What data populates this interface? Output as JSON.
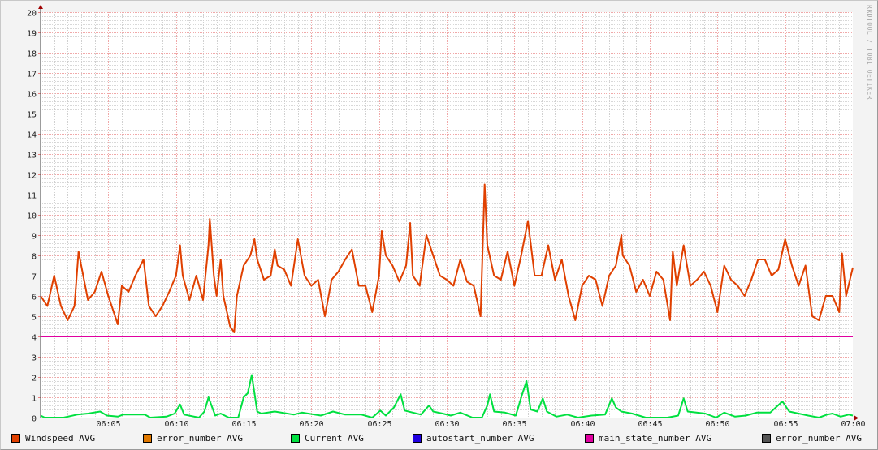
{
  "watermark": "RRDTOOL / TOBI OETIKER",
  "chart_data": {
    "type": "line",
    "title": "",
    "xlabel": "",
    "ylabel": "",
    "x_unit": "minutes after 06:00",
    "xlim": [
      0,
      60
    ],
    "ylim": [
      0,
      20
    ],
    "grid": true,
    "y_ticks": [
      "0",
      "1",
      "2",
      "3",
      "4",
      "5",
      "6",
      "7",
      "8",
      "9",
      "10",
      "11",
      "12",
      "13",
      "14",
      "15",
      "16",
      "17",
      "18",
      "19",
      "20"
    ],
    "x_ticks": [
      {
        "t": 5,
        "label": "06:05"
      },
      {
        "t": 10,
        "label": "06:10"
      },
      {
        "t": 15,
        "label": "06:15"
      },
      {
        "t": 20,
        "label": "06:20"
      },
      {
        "t": 25,
        "label": "06:25"
      },
      {
        "t": 30,
        "label": "06:30"
      },
      {
        "t": 35,
        "label": "06:35"
      },
      {
        "t": 40,
        "label": "06:40"
      },
      {
        "t": 45,
        "label": "06:45"
      },
      {
        "t": 50,
        "label": "06:50"
      },
      {
        "t": 55,
        "label": "06:55"
      },
      {
        "t": 60,
        "label": "07:00"
      }
    ],
    "legend_placement": "bottom",
    "legend": [
      {
        "label": "Windspeed AVG",
        "color": "#e04000"
      },
      {
        "label": "error_number AVG",
        "color": "#e07800"
      },
      {
        "label": "Current AVG",
        "color": "#00e040"
      },
      {
        "label": "autostart_number AVG",
        "color": "#2000e0"
      },
      {
        "label": "main_state_number AVG",
        "color": "#e000a0"
      },
      {
        "label": "error_number AVG",
        "color": "#555555"
      }
    ],
    "series": [
      {
        "name": "Windspeed AVG",
        "color": "#e04000",
        "points": [
          [
            0,
            6.0
          ],
          [
            0.5,
            5.5
          ],
          [
            1,
            7.0
          ],
          [
            1.5,
            5.5
          ],
          [
            2,
            4.8
          ],
          [
            2.5,
            5.5
          ],
          [
            2.8,
            8.2
          ],
          [
            3,
            7.5
          ],
          [
            3.5,
            5.8
          ],
          [
            4,
            6.2
          ],
          [
            4.5,
            7.2
          ],
          [
            5,
            6.0
          ],
          [
            5.5,
            5.0
          ],
          [
            5.7,
            4.6
          ],
          [
            6,
            6.5
          ],
          [
            6.5,
            6.2
          ],
          [
            7,
            7.0
          ],
          [
            7.6,
            7.8
          ],
          [
            8,
            5.5
          ],
          [
            8.5,
            5.0
          ],
          [
            9,
            5.5
          ],
          [
            9.5,
            6.2
          ],
          [
            10,
            7.0
          ],
          [
            10.3,
            8.5
          ],
          [
            10.5,
            7.0
          ],
          [
            11,
            5.8
          ],
          [
            11.5,
            7.0
          ],
          [
            12,
            5.8
          ],
          [
            12.4,
            8.5
          ],
          [
            12.5,
            9.8
          ],
          [
            12.8,
            7.0
          ],
          [
            13,
            6.0
          ],
          [
            13.3,
            7.8
          ],
          [
            13.5,
            6.0
          ],
          [
            14,
            4.5
          ],
          [
            14.3,
            4.2
          ],
          [
            14.5,
            6.0
          ],
          [
            15,
            7.5
          ],
          [
            15.5,
            8.0
          ],
          [
            15.8,
            8.8
          ],
          [
            16,
            7.8
          ],
          [
            16.5,
            6.8
          ],
          [
            17,
            7.0
          ],
          [
            17.3,
            8.3
          ],
          [
            17.5,
            7.5
          ],
          [
            18,
            7.3
          ],
          [
            18.5,
            6.5
          ],
          [
            19,
            8.8
          ],
          [
            19.5,
            7.0
          ],
          [
            20,
            6.5
          ],
          [
            20.5,
            6.8
          ],
          [
            21,
            5.0
          ],
          [
            21.5,
            6.8
          ],
          [
            22,
            7.2
          ],
          [
            22.5,
            7.8
          ],
          [
            23,
            8.3
          ],
          [
            23.5,
            6.5
          ],
          [
            24,
            6.5
          ],
          [
            24.5,
            5.2
          ],
          [
            25,
            7.0
          ],
          [
            25.2,
            9.2
          ],
          [
            25.5,
            8.0
          ],
          [
            26,
            7.5
          ],
          [
            26.5,
            6.7
          ],
          [
            27,
            7.5
          ],
          [
            27.3,
            9.6
          ],
          [
            27.5,
            7.0
          ],
          [
            28,
            6.5
          ],
          [
            28.5,
            9.0
          ],
          [
            29,
            8.0
          ],
          [
            29.5,
            7.0
          ],
          [
            30,
            6.8
          ],
          [
            30.5,
            6.5
          ],
          [
            31,
            7.8
          ],
          [
            31.5,
            6.7
          ],
          [
            32,
            6.5
          ],
          [
            32.5,
            5.0
          ],
          [
            32.8,
            11.5
          ],
          [
            33,
            8.5
          ],
          [
            33.5,
            7.0
          ],
          [
            34,
            6.8
          ],
          [
            34.5,
            8.2
          ],
          [
            35,
            6.5
          ],
          [
            35.5,
            8.0
          ],
          [
            36,
            9.7
          ],
          [
            36.5,
            7.0
          ],
          [
            37,
            7.0
          ],
          [
            37.5,
            8.5
          ],
          [
            38,
            6.8
          ],
          [
            38.5,
            7.8
          ],
          [
            39,
            6.0
          ],
          [
            39.5,
            4.8
          ],
          [
            40,
            6.5
          ],
          [
            40.5,
            7.0
          ],
          [
            41,
            6.8
          ],
          [
            41.5,
            5.5
          ],
          [
            42,
            7.0
          ],
          [
            42.5,
            7.5
          ],
          [
            42.9,
            9.0
          ],
          [
            43,
            8.0
          ],
          [
            43.5,
            7.5
          ],
          [
            44,
            6.2
          ],
          [
            44.5,
            6.8
          ],
          [
            45,
            6.0
          ],
          [
            45.5,
            7.2
          ],
          [
            46,
            6.8
          ],
          [
            46.5,
            4.8
          ],
          [
            46.7,
            8.2
          ],
          [
            47,
            6.5
          ],
          [
            47.5,
            8.5
          ],
          [
            48,
            6.5
          ],
          [
            48.5,
            6.8
          ],
          [
            49,
            7.2
          ],
          [
            49.5,
            6.5
          ],
          [
            50,
            5.2
          ],
          [
            50.5,
            7.5
          ],
          [
            51,
            6.8
          ],
          [
            51.5,
            6.5
          ],
          [
            52,
            6.0
          ],
          [
            52.5,
            6.8
          ],
          [
            53,
            7.8
          ],
          [
            53.5,
            7.8
          ],
          [
            54,
            7.0
          ],
          [
            54.5,
            7.3
          ],
          [
            55,
            8.8
          ],
          [
            55.5,
            7.5
          ],
          [
            56,
            6.5
          ],
          [
            56.5,
            7.5
          ],
          [
            57,
            5.0
          ],
          [
            57.5,
            4.8
          ],
          [
            58,
            6.0
          ],
          [
            58.5,
            6.0
          ],
          [
            59,
            5.2
          ],
          [
            59.2,
            8.1
          ],
          [
            59.5,
            6.0
          ],
          [
            60,
            7.4
          ]
        ]
      },
      {
        "name": "Current AVG",
        "color": "#00e040",
        "points": [
          [
            0,
            0.1
          ],
          [
            0.3,
            0
          ],
          [
            1.7,
            0
          ],
          [
            2.7,
            0.15
          ],
          [
            3.5,
            0.2
          ],
          [
            4.4,
            0.3
          ],
          [
            4.9,
            0.1
          ],
          [
            5.7,
            0.05
          ],
          [
            6.1,
            0.15
          ],
          [
            7.7,
            0.15
          ],
          [
            8.1,
            0
          ],
          [
            9.3,
            0.05
          ],
          [
            9.9,
            0.2
          ],
          [
            10.3,
            0.65
          ],
          [
            10.6,
            0.15
          ],
          [
            11.7,
            0
          ],
          [
            12.1,
            0.3
          ],
          [
            12.4,
            1.0
          ],
          [
            12.9,
            0.1
          ],
          [
            13.3,
            0.2
          ],
          [
            13.9,
            0
          ],
          [
            14.6,
            0
          ],
          [
            15,
            1.0
          ],
          [
            15.3,
            1.2
          ],
          [
            15.6,
            2.1
          ],
          [
            16,
            0.3
          ],
          [
            16.3,
            0.2
          ],
          [
            17.3,
            0.3
          ],
          [
            18.7,
            0.15
          ],
          [
            19.3,
            0.25
          ],
          [
            20.7,
            0.1
          ],
          [
            21.6,
            0.3
          ],
          [
            22.5,
            0.15
          ],
          [
            23.7,
            0.15
          ],
          [
            24.5,
            0
          ],
          [
            25.1,
            0.35
          ],
          [
            25.5,
            0.1
          ],
          [
            26.1,
            0.5
          ],
          [
            26.6,
            1.15
          ],
          [
            26.9,
            0.35
          ],
          [
            28.1,
            0.15
          ],
          [
            28.7,
            0.6
          ],
          [
            29,
            0.3
          ],
          [
            29.7,
            0.2
          ],
          [
            30.3,
            0.1
          ],
          [
            31,
            0.25
          ],
          [
            31.9,
            0
          ],
          [
            32.6,
            0
          ],
          [
            33,
            0.6
          ],
          [
            33.2,
            1.15
          ],
          [
            33.5,
            0.3
          ],
          [
            34.3,
            0.25
          ],
          [
            35.1,
            0.1
          ],
          [
            35.6,
            1.2
          ],
          [
            35.9,
            1.8
          ],
          [
            36.2,
            0.4
          ],
          [
            36.7,
            0.3
          ],
          [
            37.1,
            0.95
          ],
          [
            37.4,
            0.3
          ],
          [
            38.1,
            0.05
          ],
          [
            38.9,
            0.15
          ],
          [
            39.7,
            0
          ],
          [
            40.7,
            0.1
          ],
          [
            41.7,
            0.15
          ],
          [
            42.2,
            0.95
          ],
          [
            42.5,
            0.5
          ],
          [
            42.9,
            0.3
          ],
          [
            43.7,
            0.2
          ],
          [
            44.7,
            0
          ],
          [
            46.3,
            0
          ],
          [
            47.1,
            0.1
          ],
          [
            47.5,
            0.95
          ],
          [
            47.8,
            0.3
          ],
          [
            49.1,
            0.2
          ],
          [
            49.9,
            0
          ],
          [
            50.5,
            0.25
          ],
          [
            51.3,
            0.05
          ],
          [
            52.1,
            0.1
          ],
          [
            52.9,
            0.25
          ],
          [
            53.9,
            0.25
          ],
          [
            54.8,
            0.8
          ],
          [
            55.3,
            0.3
          ],
          [
            56.7,
            0.1
          ],
          [
            57.5,
            0
          ],
          [
            58.1,
            0.15
          ],
          [
            58.5,
            0.2
          ],
          [
            59.1,
            0.05
          ],
          [
            59.7,
            0.15
          ],
          [
            60,
            0.1
          ]
        ]
      },
      {
        "name": "main_state_number AVG",
        "color": "#e000a0",
        "points": [
          [
            0,
            4
          ],
          [
            60,
            4
          ]
        ]
      }
    ]
  }
}
